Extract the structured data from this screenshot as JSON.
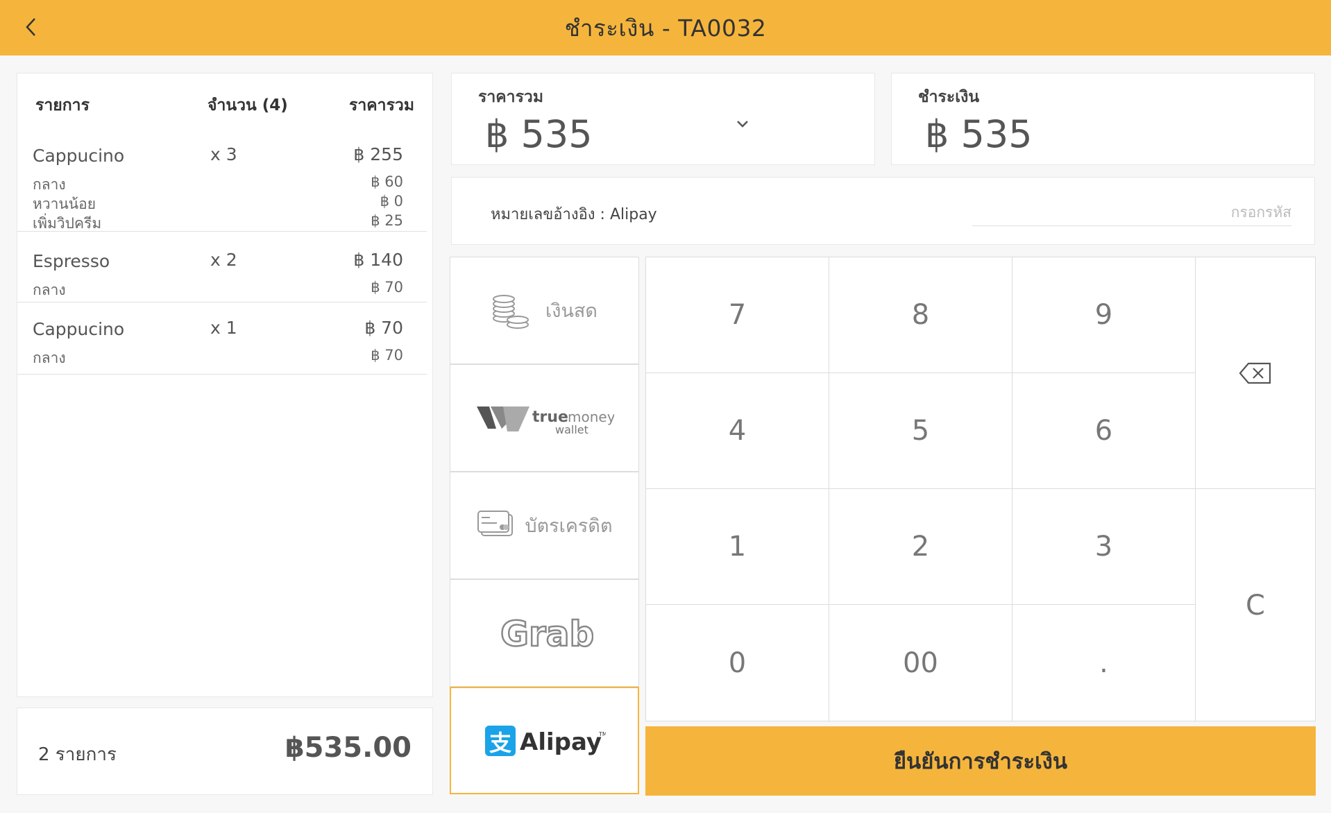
{
  "header": {
    "title": "ชำระเงิน - TA0032"
  },
  "order": {
    "columns": {
      "item": "รายการ",
      "qty": "จำนวน (4)",
      "total": "ราคารวม"
    },
    "rows": [
      {
        "name": "Cappucino",
        "qty": "x 3",
        "price": "฿ 255",
        "mods": [
          {
            "name": "กลาง",
            "price": "฿ 60"
          },
          {
            "name": "หวานน้อย",
            "price": "฿ 0"
          },
          {
            "name": "เพิ่มวิปครีม",
            "price": "฿ 25"
          }
        ]
      },
      {
        "name": "Espresso",
        "qty": "x 2",
        "price": "฿ 140",
        "mods": [
          {
            "name": "กลาง",
            "price": "฿ 70"
          }
        ]
      },
      {
        "name": "Cappucino",
        "qty": "x 1",
        "price": "฿ 70",
        "mods": [
          {
            "name": "กลาง",
            "price": "฿ 70"
          }
        ]
      }
    ],
    "summary": {
      "count": "2 รายการ",
      "total": "฿535.00"
    }
  },
  "totals": {
    "total_label": "ราคารวม",
    "total_value": "฿ 535",
    "pay_label": "ชำระเงิน",
    "pay_value": "฿ 535"
  },
  "reference": {
    "label": "หมายเลขอ้างอิง : Alipay",
    "placeholder": "กรอกรหัส"
  },
  "methods": [
    {
      "id": "cash",
      "label": "เงินสด",
      "icon": "coins-icon"
    },
    {
      "id": "truemoney",
      "label": "true money wallet",
      "icon": "truemoney-logo"
    },
    {
      "id": "credit",
      "label": "บัตรเครดิต",
      "icon": "credit-card-icon"
    },
    {
      "id": "grab",
      "label": "Grab",
      "icon": "grab-logo"
    },
    {
      "id": "alipay",
      "label": "Alipay",
      "icon": "alipay-logo",
      "active": true
    }
  ],
  "keypad": {
    "keys": [
      "7",
      "8",
      "9",
      "4",
      "5",
      "6",
      "1",
      "2",
      "3",
      "0",
      "00",
      "."
    ],
    "clear": "C",
    "backspace_icon": "backspace-icon"
  },
  "confirm": {
    "label": "ยืนยันการชำระเงิน"
  },
  "colors": {
    "accent": "#f5b53c",
    "alipay": "#1aa3e8"
  }
}
